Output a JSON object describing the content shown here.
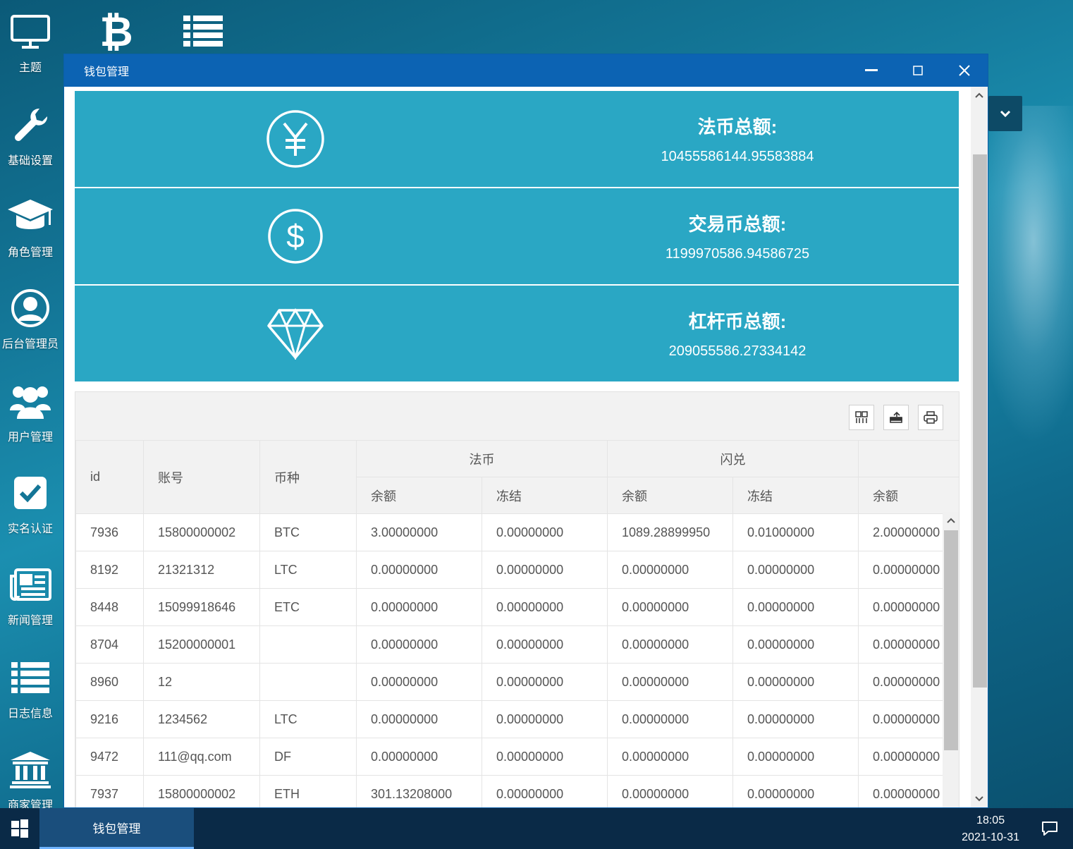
{
  "desktop": {
    "icons": [
      {
        "label": "主题",
        "icon": "monitor-icon"
      },
      {
        "label": "基础设置",
        "icon": "wrench-icon"
      },
      {
        "label": "角色管理",
        "icon": "graduation-cap-icon"
      },
      {
        "label": "后台管理员",
        "icon": "user-circle-icon"
      },
      {
        "label": "用户管理",
        "icon": "users-icon"
      },
      {
        "label": "实名认证",
        "icon": "check-square-icon"
      },
      {
        "label": "新闻管理",
        "icon": "newspaper-icon"
      },
      {
        "label": "日志信息",
        "icon": "list-icon"
      },
      {
        "label": "商家管理",
        "icon": "bank-icon"
      }
    ],
    "top_icons": [
      "bitcoin-icon",
      "list-icon"
    ]
  },
  "window": {
    "title": "钱包管理"
  },
  "summary": [
    {
      "icon": "yen-circle-icon",
      "title": "法币总额:",
      "value": "10455586144.95583884"
    },
    {
      "icon": "dollar-circle-icon",
      "title": "交易币总额:",
      "value": "1199970586.94586725"
    },
    {
      "icon": "diamond-icon",
      "title": "杠杆币总额:",
      "value": "209055586.27334142"
    }
  ],
  "toolbar": {
    "icons": [
      "columns-icon",
      "export-icon",
      "print-icon"
    ]
  },
  "table": {
    "headers": {
      "id": "id",
      "account": "账号",
      "currency": "币种",
      "group_fiat": "法币",
      "group_flash": "闪兑",
      "balance": "余额",
      "frozen": "冻结"
    },
    "rows": [
      [
        "7936",
        "15800000002",
        "BTC",
        "3.00000000",
        "0.00000000",
        "1089.28899950",
        "0.01000000",
        "2.00000000"
      ],
      [
        "8192",
        "21321312",
        "LTC",
        "0.00000000",
        "0.00000000",
        "0.00000000",
        "0.00000000",
        "0.00000000"
      ],
      [
        "8448",
        "15099918646",
        "ETC",
        "0.00000000",
        "0.00000000",
        "0.00000000",
        "0.00000000",
        "0.00000000"
      ],
      [
        "8704",
        "15200000001",
        "",
        "0.00000000",
        "0.00000000",
        "0.00000000",
        "0.00000000",
        "0.00000000"
      ],
      [
        "8960",
        "12",
        "",
        "0.00000000",
        "0.00000000",
        "0.00000000",
        "0.00000000",
        "0.00000000"
      ],
      [
        "9216",
        "1234562",
        "LTC",
        "0.00000000",
        "0.00000000",
        "0.00000000",
        "0.00000000",
        "0.00000000"
      ],
      [
        "9472",
        "111@qq.com",
        "DF",
        "0.00000000",
        "0.00000000",
        "0.00000000",
        "0.00000000",
        "0.00000000"
      ],
      [
        "7937",
        "15800000002",
        "ETH",
        "301.13208000",
        "0.00000000",
        "0.00000000",
        "0.00000000",
        "0.00000000"
      ]
    ]
  },
  "taskbar": {
    "task": "钱包管理",
    "time": "18:05",
    "date": "2021-10-31"
  }
}
